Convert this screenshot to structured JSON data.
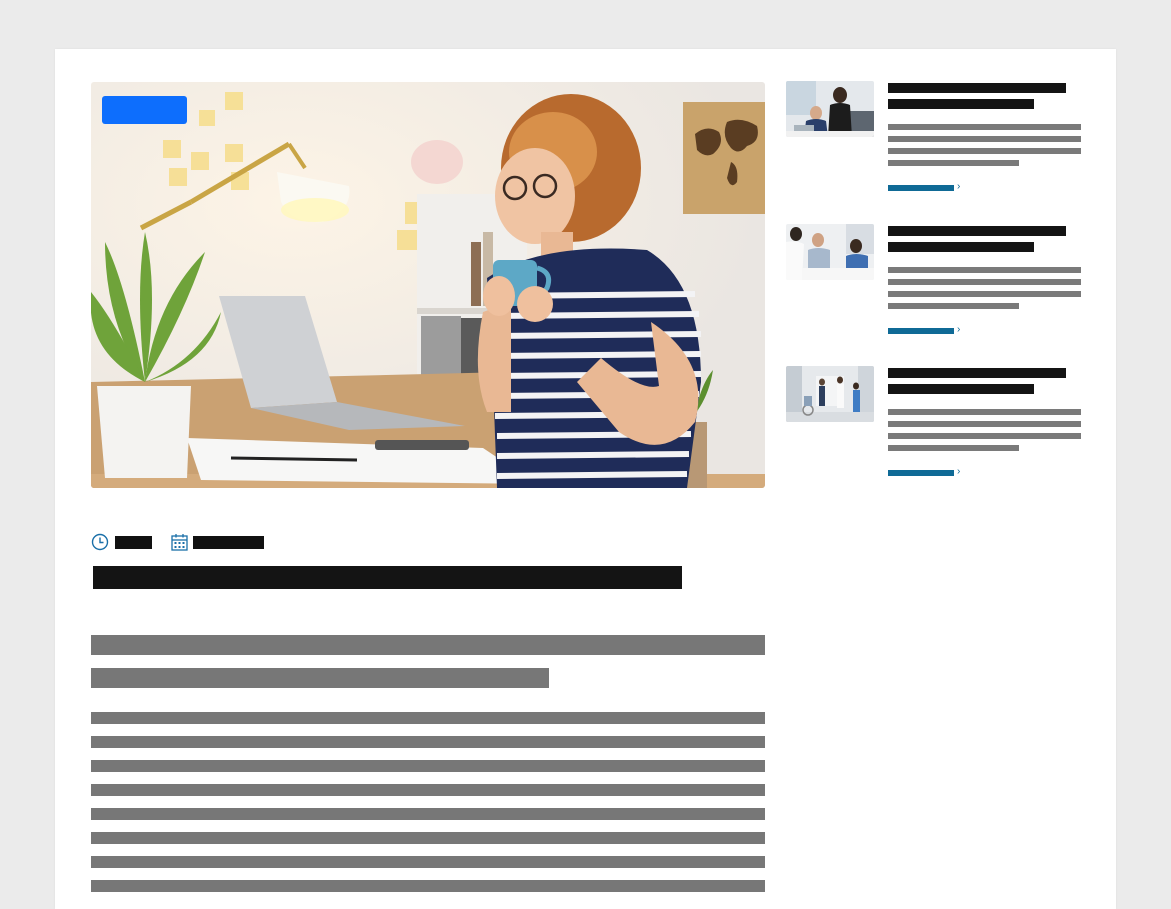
{
  "colors": {
    "page_background": "#ebebeb",
    "card": "#ffffff",
    "badge": "#0d6efd",
    "redacted_heading": "#141414",
    "redacted_text": "#777777",
    "link": "#0f6a96",
    "meta_icon": "#1a6fa8"
  },
  "article": {
    "hero_image": "woman-drinking-coffee-at-desk",
    "category_badge": "",
    "read_time_icon": "clock-icon",
    "date_icon": "calendar-icon",
    "read_time": "",
    "date": "",
    "title": "",
    "lead": "",
    "body": ""
  },
  "sidebar": {
    "articles": [
      {
        "thumbnail": "office-meeting-photo",
        "title": "",
        "excerpt": "",
        "link_label": "",
        "chevron": "›"
      },
      {
        "thumbnail": "clinic-consultation-photo",
        "title": "",
        "excerpt": "",
        "link_label": "",
        "chevron": "›"
      },
      {
        "thumbnail": "hospital-corridor-photo",
        "title": "",
        "excerpt": "",
        "link_label": "",
        "chevron": "›"
      }
    ]
  }
}
